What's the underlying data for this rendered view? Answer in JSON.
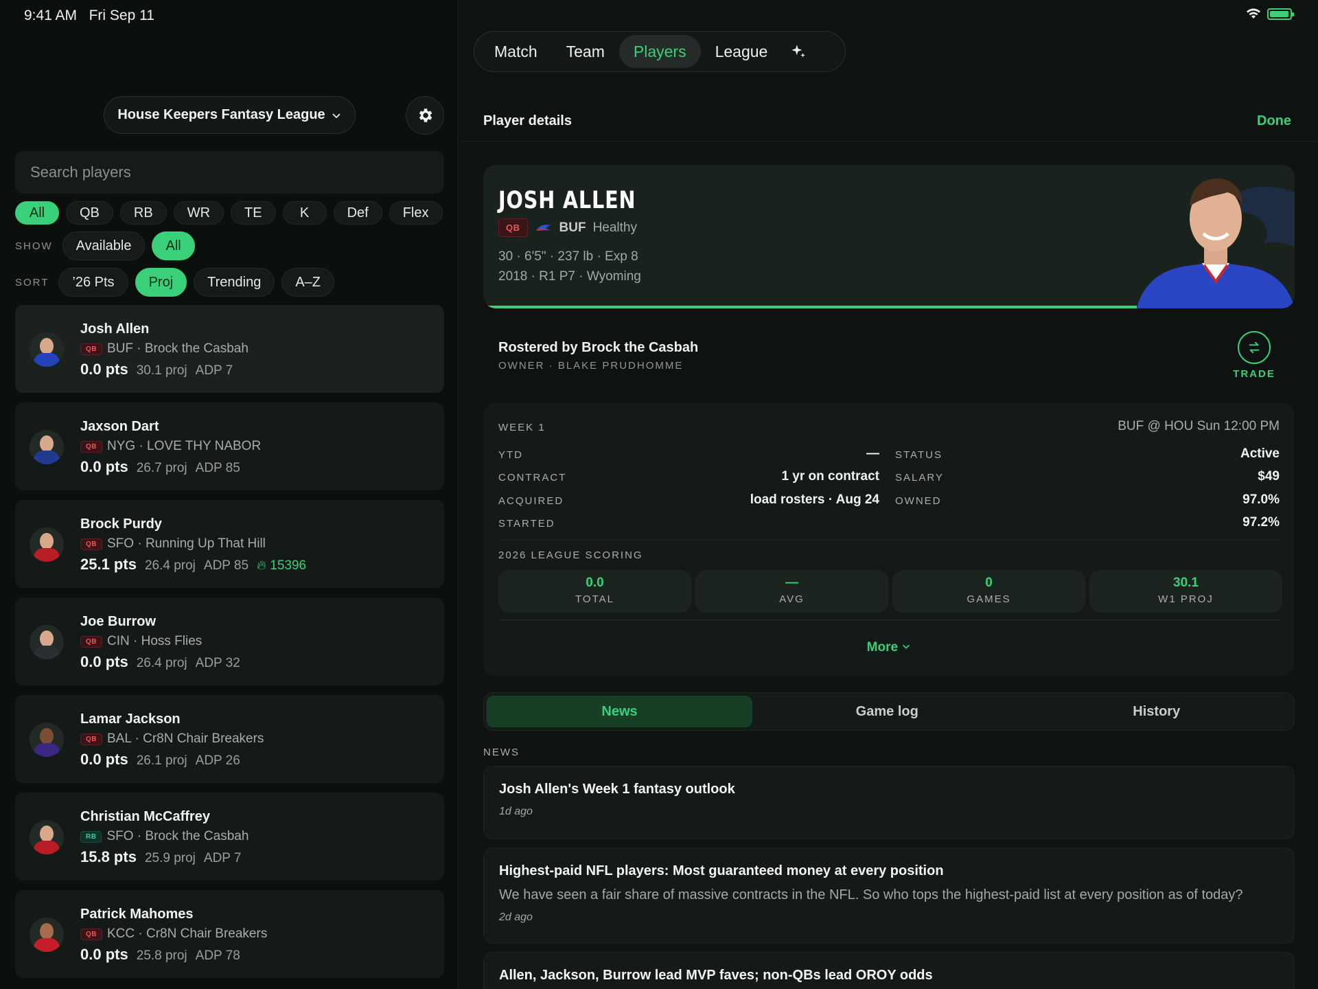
{
  "status": {
    "time": "9:41 AM",
    "date": "Fri Sep 11"
  },
  "league": {
    "name": "House Keepers Fantasy League"
  },
  "search": {
    "placeholder": "Search players"
  },
  "positions": [
    "All",
    "QB",
    "RB",
    "WR",
    "TE",
    "K",
    "Def",
    "Flex"
  ],
  "show": {
    "label": "SHOW",
    "options": [
      "Available",
      "All"
    ]
  },
  "sort": {
    "label": "SORT",
    "options": [
      "’26 Pts",
      "Proj",
      "Trending",
      "A–Z"
    ]
  },
  "players": [
    {
      "name": "Josh Allen",
      "pos": "QB",
      "team_owner": "BUF · Brock the Casbah",
      "pts": "0.0 pts",
      "proj": "30.1 proj",
      "adp": "ADP 7",
      "trend": ""
    },
    {
      "name": "Jaxson Dart",
      "pos": "QB",
      "team_owner": "NYG · LOVE THY NABOR",
      "pts": "0.0 pts",
      "proj": "26.7 proj",
      "adp": "ADP 85",
      "trend": ""
    },
    {
      "name": "Brock Purdy",
      "pos": "QB",
      "team_owner": "SFO · Running Up That Hill",
      "pts": "25.1 pts",
      "proj": "26.4 proj",
      "adp": "ADP 85",
      "trend": "15396"
    },
    {
      "name": "Joe Burrow",
      "pos": "QB",
      "team_owner": "CIN · Hoss Flies",
      "pts": "0.0 pts",
      "proj": "26.4 proj",
      "adp": "ADP 32",
      "trend": ""
    },
    {
      "name": "Lamar Jackson",
      "pos": "QB",
      "team_owner": "BAL · Cr8N Chair Breakers",
      "pts": "0.0 pts",
      "proj": "26.1 proj",
      "adp": "ADP 26",
      "trend": ""
    },
    {
      "name": "Christian McCaffrey",
      "pos": "RB",
      "team_owner": "SFO · Brock the Casbah",
      "pts": "15.8 pts",
      "proj": "25.9 proj",
      "adp": "ADP 7",
      "trend": ""
    },
    {
      "name": "Patrick Mahomes",
      "pos": "QB",
      "team_owner": "KCC · Cr8N Chair Breakers",
      "pts": "0.0 pts",
      "proj": "25.8 proj",
      "adp": "ADP 78",
      "trend": ""
    }
  ],
  "tabs": [
    "Match",
    "Team",
    "Players",
    "League"
  ],
  "detail": {
    "title": "Player details",
    "done": "Done",
    "name": "JOSH ALLEN",
    "pos": "QB",
    "team": "BUF",
    "health": "Healthy",
    "bio": "30 · 6'5\" · 237 lb · Exp 8",
    "draft": "2018 · R1 P7 · Wyoming",
    "rostered": "Rostered by Brock the Casbah",
    "owner": "OWNER · BLAKE PRUDHOMME",
    "trade": "TRADE",
    "week": "WEEK 1",
    "game": "BUF @ HOU Sun 12:00 PM",
    "ytd_label": "YTD",
    "ytd": "—",
    "status_label": "STATUS",
    "status": "Active",
    "contract_label": "CONTRACT",
    "contract": "1 yr on contract",
    "salary_label": "SALARY",
    "salary": "$49",
    "acquired_label": "ACQUIRED",
    "acquired": "load rosters · Aug 24",
    "owned_label": "OWNED",
    "owned": "97.0%",
    "started_label": "STARTED",
    "started": "97.2%",
    "scoring_label": "2026 LEAGUE SCORING",
    "tiles": [
      {
        "value": "0.0",
        "label": "TOTAL"
      },
      {
        "value": "—",
        "label": "AVG"
      },
      {
        "value": "0",
        "label": "GAMES"
      },
      {
        "value": "30.1",
        "label": "W1 PROJ"
      }
    ],
    "more": "More"
  },
  "segments": [
    "News",
    "Game log",
    "History"
  ],
  "news_label": "NEWS",
  "news": [
    {
      "title": "Josh Allen's Week 1 fantasy outlook",
      "body": "",
      "time": "1d ago"
    },
    {
      "title": "Highest-paid NFL players: Most guaranteed money at every position",
      "body": "We have seen a fair share of massive contracts in the NFL. So who tops the highest-paid list at every position as of today?",
      "time": "2d ago"
    },
    {
      "title": "Allen, Jackson, Burrow lead MVP faves; non-QBs lead OROY odds",
      "body": "",
      "time": ""
    }
  ],
  "colors": {
    "accent": "#3ad07a",
    "background": "#0b0f0d",
    "qb_badge": "#e85a5a",
    "rb_badge": "#3fcaa0"
  }
}
